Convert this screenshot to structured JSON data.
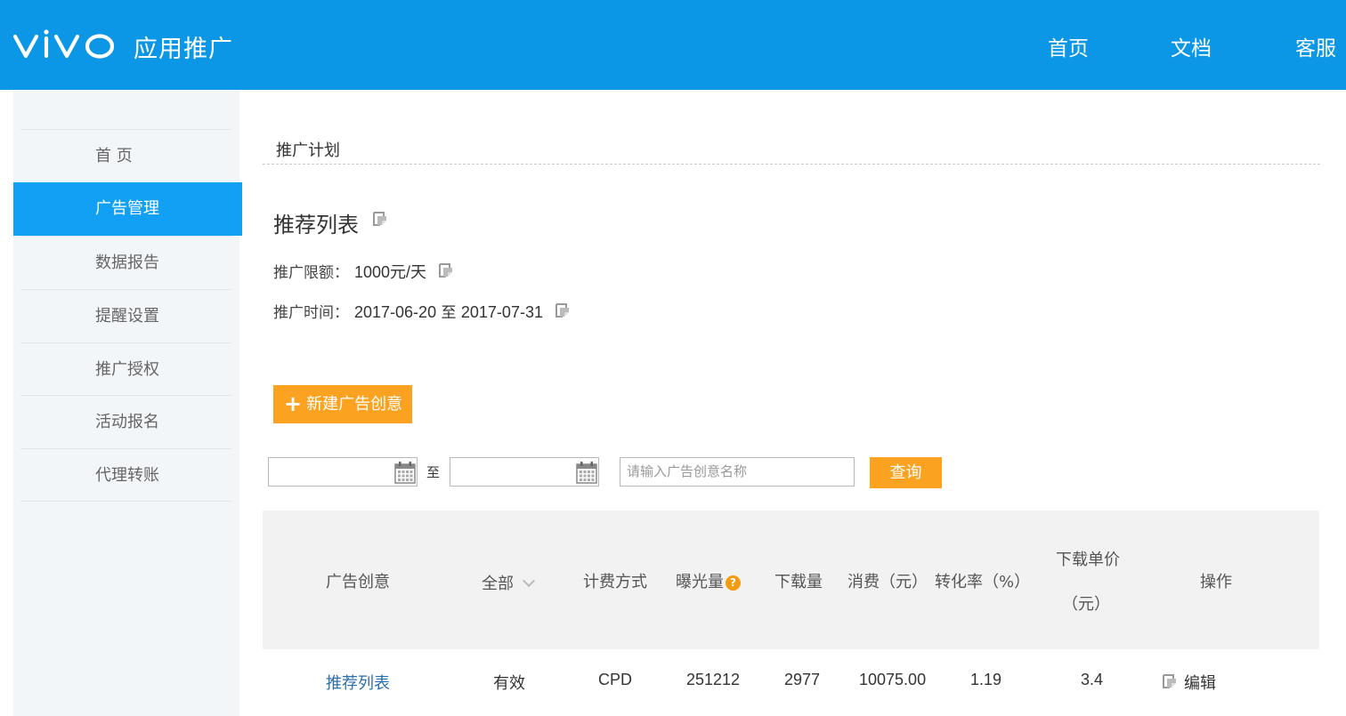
{
  "header": {
    "logo_text": "vivo",
    "app_title": "应用推广",
    "nav": [
      "首页",
      "文档",
      "客服"
    ]
  },
  "sidebar": {
    "items": [
      {
        "label": "首 页",
        "active": false
      },
      {
        "label": "广告管理",
        "active": true
      },
      {
        "label": "数据报告",
        "active": false
      },
      {
        "label": "提醒设置",
        "active": false
      },
      {
        "label": "推广授权",
        "active": false
      },
      {
        "label": "活动报名",
        "active": false
      },
      {
        "label": "代理转账",
        "active": false
      }
    ]
  },
  "main": {
    "breadcrumb": "推广计划",
    "title": "推荐列表",
    "budget_label": "推广限额：",
    "budget_value": "1000元/天",
    "time_label": "推广时间：",
    "time_start": "2017-06-20",
    "time_sep": "至",
    "time_end": "2017-07-31",
    "new_button": "新建广告创意",
    "filter": {
      "start_date": "",
      "to_label": "至",
      "end_date": "",
      "search_placeholder": "请输入广告创意名称",
      "query_button": "查询"
    }
  },
  "table": {
    "headers": {
      "creative": "广告创意",
      "status_filter": "全部",
      "billing": "计费方式",
      "impressions": "曝光量",
      "downloads": "下载量",
      "cost": "消费（元）",
      "conversion": "转化率（%）",
      "unit_price_line1": "下载单价",
      "unit_price_line2": "（元）",
      "actions": "操作"
    },
    "rows": [
      {
        "creative": "推荐列表",
        "status": "有效",
        "billing": "CPD",
        "impressions": "251212",
        "downloads": "2977",
        "cost": "10075.00",
        "conversion": "1.19",
        "unit_price": "3.4",
        "action": "编辑"
      }
    ]
  },
  "colors": {
    "header_bg": "#0b96e6",
    "active_nav": "#12a0f5",
    "accent_orange": "#fba321",
    "link": "#2a6fb0"
  }
}
